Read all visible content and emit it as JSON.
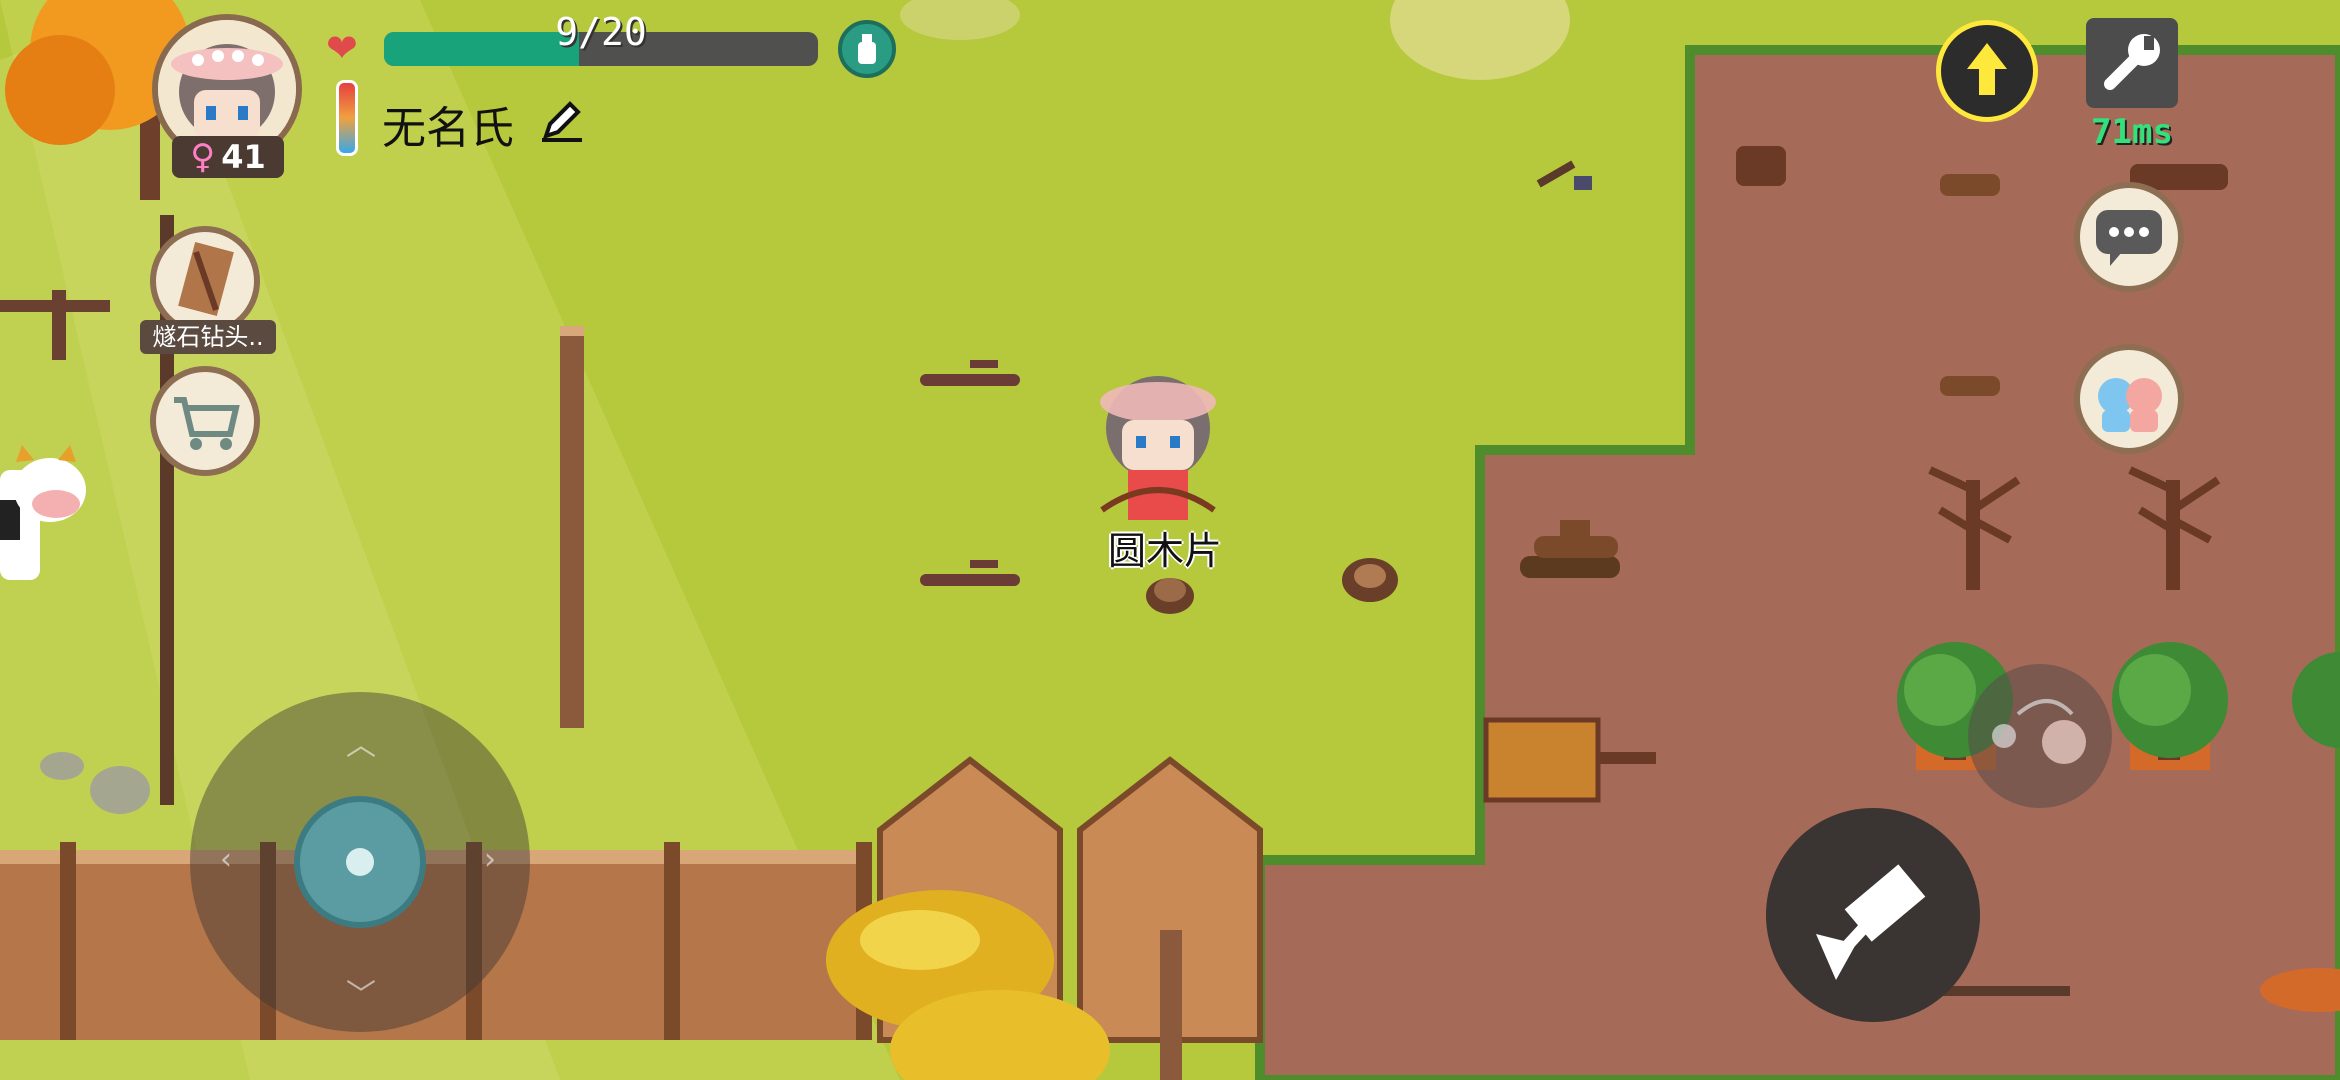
{
  "player": {
    "hp_text": "9/20",
    "hp_fraction": 0.45,
    "name": "无名氏",
    "age": "41",
    "gender_symbol": "♀"
  },
  "hud": {
    "held_item_label": "燧石钻头..",
    "ping": "71ms",
    "heart_symbol": "❤"
  },
  "world": {
    "object_label": "圆木片"
  },
  "colors": {
    "grass": "#b6c83c",
    "dirt": "#a66a58",
    "hp_fill": "#19a37a",
    "ping_green": "#34e07a",
    "highlight_ring": "#ffe83c"
  },
  "icons": [
    "heart-icon",
    "thermometer-icon",
    "bottle-icon",
    "edit-icon",
    "shop-cart-icon",
    "up-arrow-icon",
    "wrench-icon",
    "chat-icon",
    "emote-icon",
    "action-tool-icon",
    "throw-icon"
  ]
}
